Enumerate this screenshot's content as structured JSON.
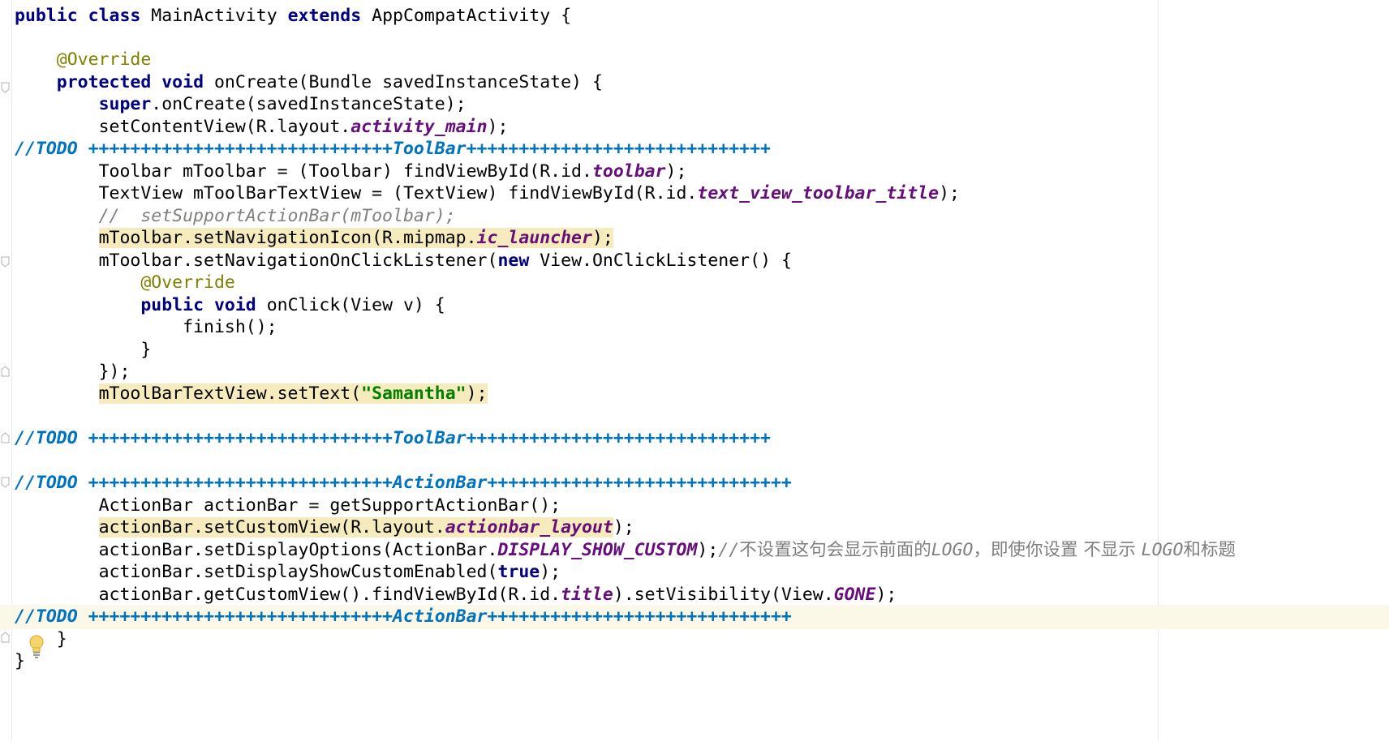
{
  "editor": {
    "colors": {
      "keyword": "#000080",
      "annotation": "#808000",
      "field": "#660e7a",
      "todo": "#0073bf",
      "comment": "#808080",
      "string": "#008000",
      "warning_highlight": "#f6ebbc",
      "caret_row": "#fcf8e8"
    },
    "icons": {
      "gutter_fold": "fold-marker-icon",
      "intention": "lightbulb-icon"
    },
    "code": {
      "l1": {
        "kw1": "public",
        "kw2": "class",
        "t1": " MainActivity ",
        "kw3": "extends",
        "t2": " AppCompatActivity {"
      },
      "l3": {
        "anno": "@Override"
      },
      "l4": {
        "kw1": "protected",
        "kw2": "void",
        "t1": " onCreate(Bundle savedInstanceState) {"
      },
      "l5": {
        "kw1": "super",
        "t1": ".onCreate(savedInstanceState);"
      },
      "l6": {
        "t1": "setContentView(R.layout.",
        "f1": "activity_main",
        "t2": ");"
      },
      "l7": {
        "todo": "//TODO +++++++++++++++++++++++++++++ToolBar+++++++++++++++++++++++++++++"
      },
      "l8": {
        "t1": "Toolbar mToolbar = (Toolbar) findViewById(R.id.",
        "f1": "toolbar",
        "t2": ");"
      },
      "l9": {
        "t1": "TextView mToolBarTextView = (TextView) findViewById(R.id.",
        "f1": "text_view_toolbar_title",
        "t2": ");"
      },
      "l10": {
        "cmt": "//  setSupportActionBar(mToolbar);"
      },
      "l11": {
        "t1": "mToolbar.setNavigationIcon(R.mipmap.",
        "f1": "ic_launcher",
        "t2": ");"
      },
      "l12": {
        "t1": "mToolbar.setNavigationOnClickListener(",
        "kw1": "new",
        "t2": " View.OnClickListener() {"
      },
      "l13": {
        "anno": "@Override"
      },
      "l14": {
        "kw1": "public",
        "kw2": "void",
        "t1": " onClick(View v) {"
      },
      "l15": {
        "t1": "finish();"
      },
      "l16": {
        "t1": "}"
      },
      "l17": {
        "t1": "});"
      },
      "l18": {
        "t1": "mToolBarTextView.setText(",
        "str": "\"Samantha\"",
        "t2": ");"
      },
      "l20": {
        "todo": "//TODO +++++++++++++++++++++++++++++ToolBar+++++++++++++++++++++++++++++"
      },
      "l22": {
        "todo": "//TODO +++++++++++++++++++++++++++++ActionBar+++++++++++++++++++++++++++++"
      },
      "l23": {
        "t1": "ActionBar actionBar = getSupportActionBar();"
      },
      "l24": {
        "t1": "actionBar.setCustomView(R.layout.",
        "f1": "actionbar_layout",
        "t2": ");"
      },
      "l25": {
        "t1": "actionBar.setDisplayOptions(ActionBar.",
        "f1": "DISPLAY_SHOW_CUSTOM",
        "t2": ");",
        "cmt_a": "//",
        "cmt_b": "不设置这句会显示前面的",
        "cmt_c": "LOGO",
        "cmt_d": "，即使你设置 不显示 ",
        "cmt_e": "LOGO",
        "cmt_f": "和标题"
      },
      "l26": {
        "t1": "actionBar.setDisplayShowCustomEnabled(",
        "kw1": "true",
        "t2": ");"
      },
      "l27": {
        "t1": "actionBar.getCustomView().findViewById(R.id.",
        "f1": "title",
        "t2": ").setVisibility(View.",
        "f2": "GONE",
        "t3": ");"
      },
      "l28": {
        "todo": "//TODO +++++++++++++++++++++++++++++ActionBar+++++++++++++++++++++++++++++"
      },
      "l29": {
        "t1": "}"
      },
      "l30": {
        "t1": "}"
      }
    }
  }
}
